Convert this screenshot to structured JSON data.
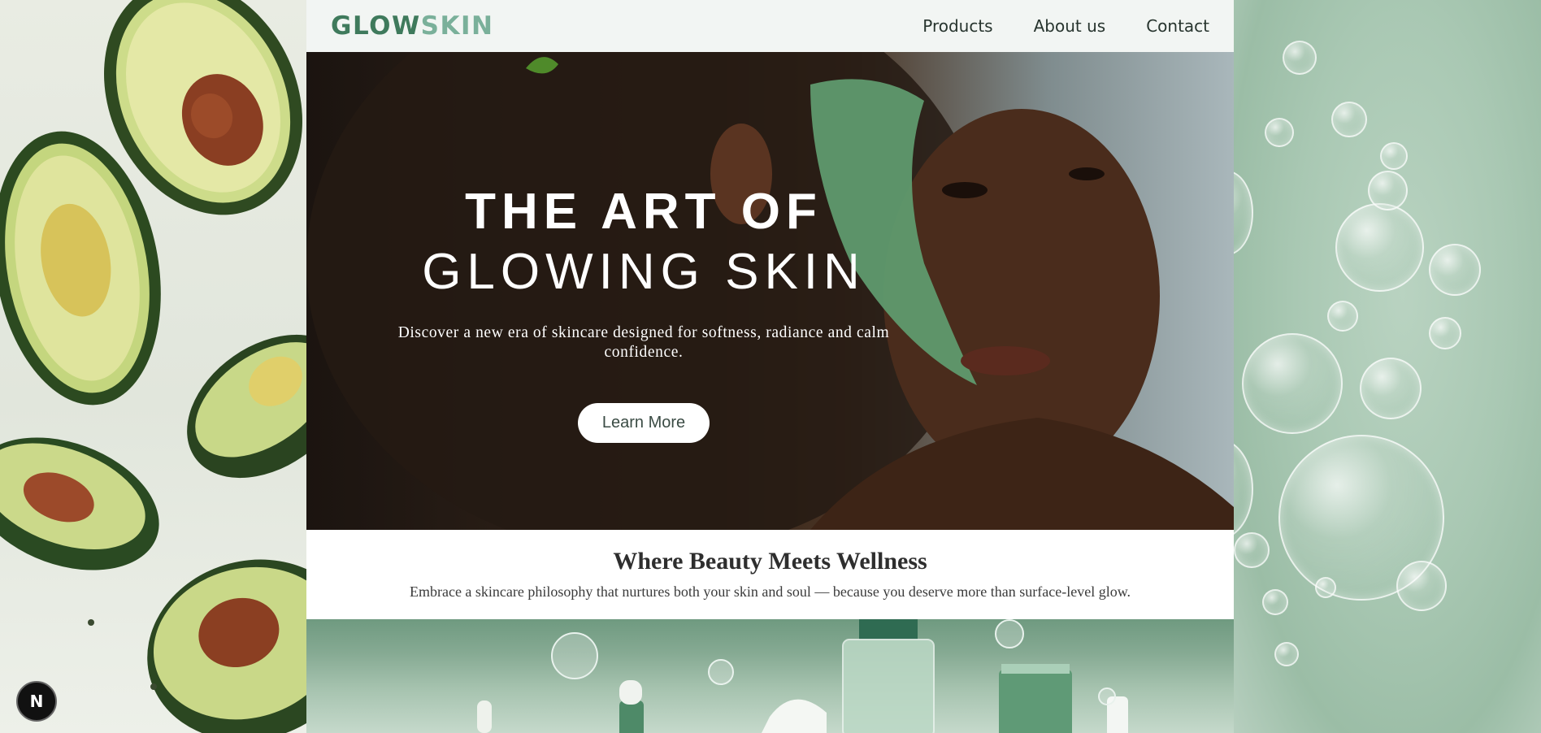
{
  "brand": {
    "logo_part1": "GLOW",
    "logo_part2": "SKIN"
  },
  "nav": {
    "items": [
      {
        "label": "Products"
      },
      {
        "label": "About us"
      },
      {
        "label": "Contact"
      }
    ]
  },
  "hero": {
    "title_line1": "THE ART OF",
    "title_line2": "GLOWING SKIN",
    "subtitle": "Discover a new era of skincare designed for softness, radiance and calm confidence.",
    "cta_label": "Learn More"
  },
  "intro": {
    "heading": "Where Beauty Meets Wellness",
    "text": "Embrace a skincare philosophy that nurtures both your skin and soul — because you deserve more than surface-level glow."
  },
  "badge": {
    "label": "N"
  },
  "colors": {
    "logo_primary": "#3f7a5c",
    "logo_secondary": "#7ab09a",
    "nav_bg": "#f2f5f3",
    "accent_green": "#5f9a76"
  },
  "images": {
    "left_background": "avocado-halves",
    "right_background": "water-bubbles",
    "hero": "woman-green-face-mask",
    "products_banner": "skincare-bottles-green"
  }
}
